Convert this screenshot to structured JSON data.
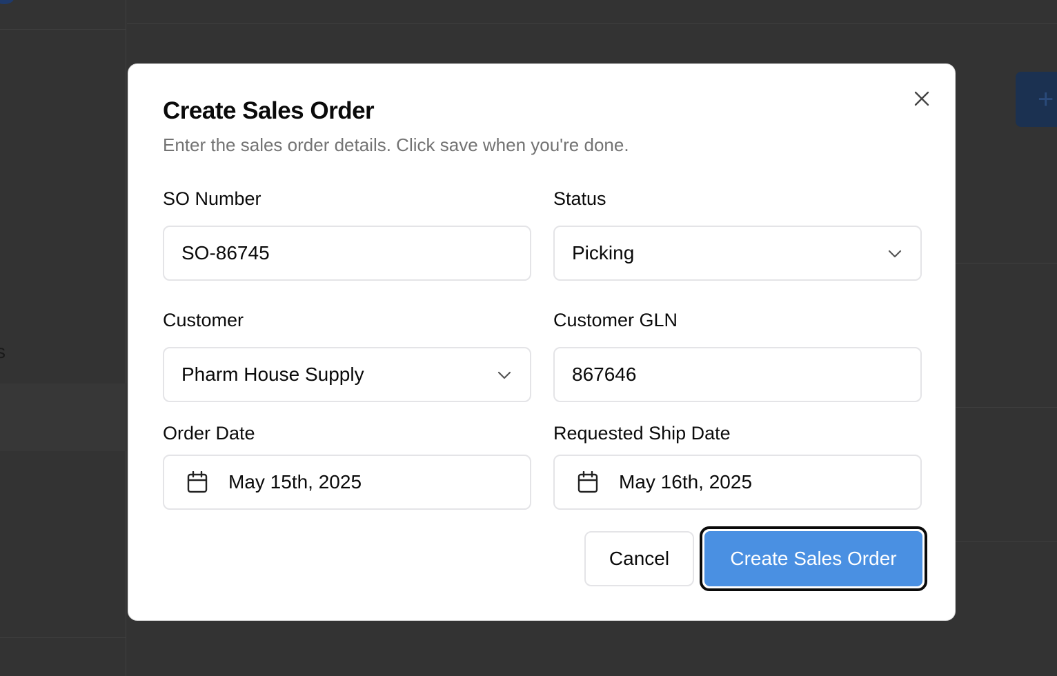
{
  "background": {
    "sidebar_partial_text": "s",
    "add_button_icon": "+"
  },
  "dialog": {
    "title": "Create Sales Order",
    "description": "Enter the sales order details. Click save when you're done.",
    "close_icon": "close-icon",
    "fields": {
      "so_number": {
        "label": "SO Number",
        "value": "SO-86745"
      },
      "status": {
        "label": "Status",
        "value": "Picking"
      },
      "customer": {
        "label": "Customer",
        "value": "Pharm House Supply"
      },
      "customer_gln": {
        "label": "Customer GLN",
        "value": "867646"
      },
      "order_date": {
        "label": "Order Date",
        "value": "May 15th, 2025"
      },
      "requested_ship_date": {
        "label": "Requested Ship Date",
        "value": "May 16th, 2025"
      }
    },
    "buttons": {
      "cancel": "Cancel",
      "submit": "Create Sales Order"
    }
  },
  "colors": {
    "primary": "#4a90e2",
    "overlay": "#333333",
    "border": "#e4e4e7",
    "muted_text": "#737373"
  }
}
